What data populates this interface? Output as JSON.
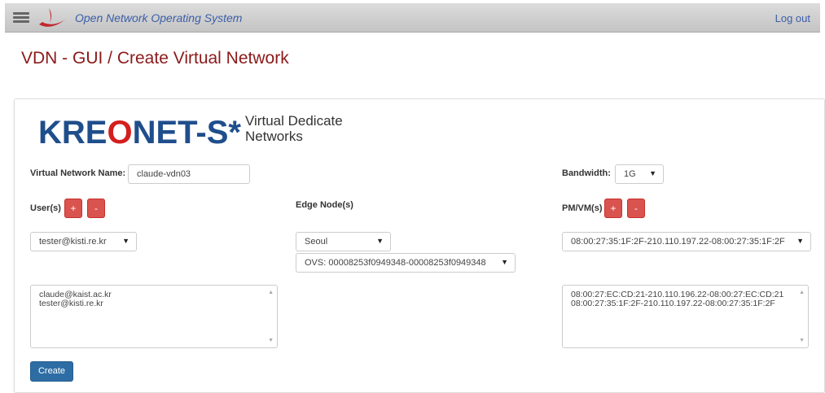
{
  "header": {
    "app_title": "Open Network Operating System",
    "logout_label": "Log out",
    "menu_icon": "hamburger-menu-icon",
    "logo_icon": "onos-swoosh-logo-icon"
  },
  "page": {
    "title": "VDN - GUI / Create Virtual Network"
  },
  "brand": {
    "name_pre": "KRE",
    "name_o": "O",
    "name_post": "NET-S*",
    "subtitle_line1": "Virtual Dedicate",
    "subtitle_line2": "Networks",
    "color_primary": "#1f4e8c",
    "color_accent": "#d31f1f"
  },
  "form": {
    "vn_name_label": "Virtual Network Name:",
    "vn_name_value": "claude-vdn03",
    "bandwidth_label": "Bandwidth:",
    "bandwidth_value": "1G",
    "users_label": "User(s)",
    "edge_label": "Edge Node(s)",
    "pmvm_label": "PM/VM(s)",
    "add_label": "+",
    "remove_label": "-",
    "user_select_value": "tester@kisti.re.kr",
    "edge_select_value": "Seoul",
    "ovs_select_value": "OVS: 00008253f0949348-00008253f0949348",
    "pmvm_select_value": "08:00:27:35:1F:2F-210.110.197.22-08:00:27:35:1F:2F",
    "users_list": [
      "claude@kaist.ac.kr",
      "tester@kisti.re.kr"
    ],
    "pmvm_list": [
      "08:00:27:EC:CD:21-210.110.196.22-08:00:27:EC:CD:21",
      "08:00:27:35:1F:2F-210.110.197.22-08:00:27:35:1F:2F"
    ],
    "create_label": "Create"
  },
  "colors": {
    "title_red": "#8b1a1a",
    "link_blue": "#3b5ea8",
    "danger": "#d9534f",
    "primary_button": "#2e6da4"
  }
}
